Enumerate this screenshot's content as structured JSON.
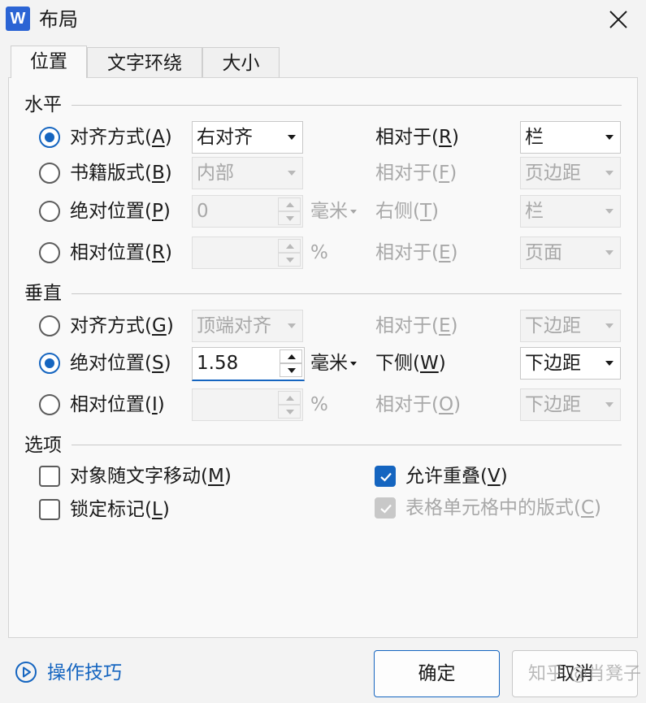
{
  "window": {
    "title": "布局",
    "app_icon_letter": "W"
  },
  "tabs": [
    {
      "label": "位置",
      "active": true
    },
    {
      "label": "文字环绕",
      "active": false
    },
    {
      "label": "大小",
      "active": false
    }
  ],
  "horizontal": {
    "section_label": "水平",
    "align": {
      "label_text": "对齐方式(",
      "label_key": "A",
      "label_end": ")",
      "value": "右对齐",
      "relative_label_text": "相对于(",
      "relative_key": "R",
      "relative_end": ")",
      "relative_value": "栏"
    },
    "book": {
      "label_text": "书籍版式(",
      "label_key": "B",
      "label_end": ")",
      "value": "内部",
      "relative_label_text": "相对于(",
      "relative_key": "F",
      "relative_end": ")",
      "relative_value": "页边距"
    },
    "absolute": {
      "label_text": "绝对位置(",
      "label_key": "P",
      "label_end": ")",
      "value": "0",
      "unit": "毫米",
      "relative_label_text": "右侧(",
      "relative_key": "T",
      "relative_end": ")",
      "relative_value": "栏"
    },
    "relative": {
      "label_text": "相对位置(",
      "label_key": "R",
      "label_end": ")",
      "value": "",
      "unit": "%",
      "relative_label_text": "相对于(",
      "relative_key": "E",
      "relative_end": ")",
      "relative_value": "页面"
    }
  },
  "vertical": {
    "section_label": "垂直",
    "align": {
      "label_text": "对齐方式(",
      "label_key": "G",
      "label_end": ")",
      "value": "顶端对齐",
      "relative_label_text": "相对于(",
      "relative_key": "E",
      "relative_end": ")",
      "relative_value": "下边距"
    },
    "absolute": {
      "label_text": "绝对位置(",
      "label_key": "S",
      "label_end": ")",
      "value": "1.58",
      "unit": "毫米",
      "relative_label_text": "下侧(",
      "relative_key": "W",
      "relative_end": ")",
      "relative_value": "下边距"
    },
    "relative": {
      "label_text": "相对位置(",
      "label_key": "I",
      "label_end": ")",
      "value": "",
      "unit": "%",
      "relative_label_text": "相对于(",
      "relative_key": "O",
      "relative_end": ")",
      "relative_value": "下边距"
    }
  },
  "options": {
    "section_label": "选项",
    "move_with_text": {
      "text": "对象随文字移动(",
      "key": "M",
      "end": ")",
      "checked": false
    },
    "lock_anchor": {
      "text": "锁定标记(",
      "key": "L",
      "end": ")",
      "checked": false
    },
    "allow_overlap": {
      "text": "允许重叠(",
      "key": "V",
      "end": ")",
      "checked": true
    },
    "layout_in_cell": {
      "text": "表格单元格中的版式(",
      "key": "C",
      "end": ")",
      "checked": true,
      "disabled": true
    }
  },
  "footer": {
    "tips_label": "操作技巧",
    "ok_label": "确定",
    "cancel_label": "取消",
    "watermark": "知乎 @肖凳子"
  },
  "colors": {
    "accent": "#1565c0",
    "disabled_text": "#a8a8a8",
    "background": "#f3f3f3"
  }
}
